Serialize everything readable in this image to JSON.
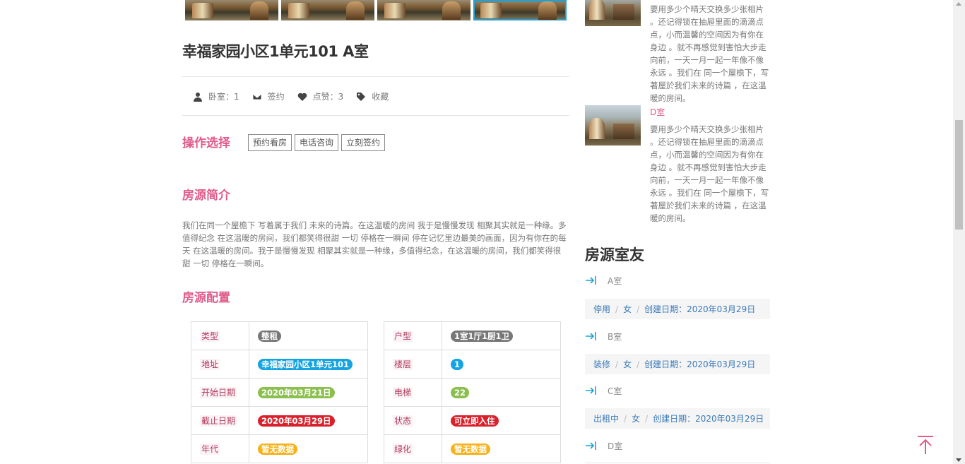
{
  "gallery": {
    "count": 4,
    "active_index": 3
  },
  "title": "幸福家园小区1单元101 A室",
  "meta": {
    "bedroom": "卧室：1",
    "sign": "签约",
    "likes": "点赞：3",
    "favorite": "收藏"
  },
  "operations": {
    "heading": "操作选择",
    "buttons": [
      "预约看房",
      "电话咨询",
      "立刻签约"
    ]
  },
  "intro": {
    "heading": "房源简介",
    "text": "我们在同一个屋檐下 写着属于我们 未来的诗篇。在这温暖的房间 我于是慢慢发现 相聚其实就是一种缘。多值得纪念 在这温暖的房间，我们都笑得很甜 一切 停格在一瞬间 停在记忆里边最美的画面，因为有你在的每天 在这温暖的房间。我于是慢慢发现 相聚其实就是一种缘，多值得纪念，在这温暖的房间，我们都笑得很甜 一切 停格在一瞬间。"
  },
  "config": {
    "heading": "房源配置",
    "left": [
      {
        "key": "类型",
        "value": "整租",
        "color": "#777777"
      },
      {
        "key": "地址",
        "value": "幸福家园小区1单元101",
        "color": "#16a3e1"
      },
      {
        "key": "开始日期",
        "value": "2020年03月21日",
        "color": "#8bbf4e"
      },
      {
        "key": "截止日期",
        "value": "2020年03月29日",
        "color": "#d9212c"
      },
      {
        "key": "年代",
        "value": "暂无数据",
        "color": "#f5b21a"
      }
    ],
    "right": [
      {
        "key": "户型",
        "value": "1室1厅1厨1卫",
        "color": "#777777"
      },
      {
        "key": "楼层",
        "value": "1",
        "color": "#16a3e1"
      },
      {
        "key": "电梯",
        "value": "22",
        "color": "#8bbf4e"
      },
      {
        "key": "状态",
        "value": "可立即入住",
        "color": "#d9212c"
      },
      {
        "key": "绿化",
        "value": "暂无数据",
        "color": "#f5b21a"
      }
    ]
  },
  "sidebar": {
    "room_text_1": "要用多少个晴天交换多少张相片 。还记得锁在抽屉里面的滴滴点点，小而温馨的空间因为有你在身边 。就不再感觉到害怕大步走向前，一天一月一起一年像不像永远 。我们在 同一个屋檐下，写著屋於我们未来的诗篇 ，在这温暖的房间。",
    "room_link_2": "D室",
    "room_text_2": "要用多少个晴天交换多少张相片 。还记得锁在抽屉里面的滴滴点点，小而温馨的空间因为有你在身边 。就不再感觉到害怕大步走向前，一天一月一起一年像不像永远 。我们在 同一个屋檐下，写著屋於我们未来的诗篇 ，在这温暖的房间。",
    "mates_heading": "房源室友",
    "mates": [
      {
        "room": "A室",
        "status": "停用",
        "gender": "女",
        "created": "创建日期：2020年03月29日"
      },
      {
        "room": "B室",
        "status": "装修",
        "gender": "女",
        "created": "创建日期：2020年03月29日"
      },
      {
        "room": "C室",
        "status": "出租中",
        "gender": "女",
        "created": "创建日期：2020年03月29日"
      },
      {
        "room": "D室"
      }
    ]
  },
  "colors": {
    "accent": "#e05c8c",
    "link": "#3a7ab8",
    "arrow": "#1aa2d9",
    "gallery_active": "#1aa2d9"
  }
}
